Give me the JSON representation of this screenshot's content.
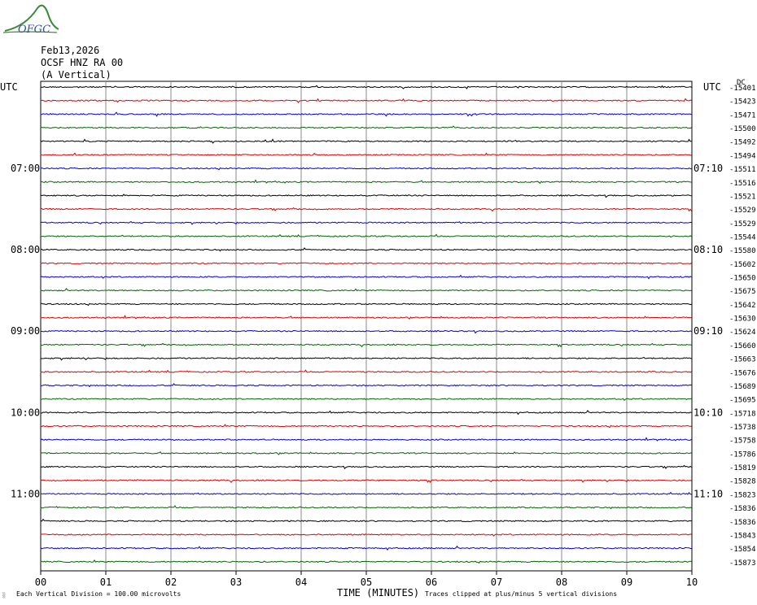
{
  "header": {
    "logo_text": "OFGC",
    "date": "Feb13,2026",
    "station": "OCSF HNZ RA 00",
    "component": "(A Vertical)"
  },
  "chart_data": {
    "type": "line",
    "title": "Feb13,2026",
    "left_axis_label": "UTC",
    "right_axis_label": "UTC",
    "right_axis_unit": "DC",
    "xlabel": "TIME (MINUTES)",
    "x_ticks": [
      "00",
      "01",
      "02",
      "03",
      "04",
      "05",
      "06",
      "07",
      "08",
      "09",
      "10"
    ],
    "xlim": [
      0,
      10
    ],
    "left_hour_labels": [
      "07:00",
      "08:00",
      "09:00",
      "10:00",
      "11:00"
    ],
    "right_hour_labels": [
      "07:10",
      "08:10",
      "09:10",
      "10:10",
      "11:10"
    ],
    "hour_label_trace_index": [
      6,
      12,
      18,
      24,
      30
    ],
    "trace_colors": [
      "#000000",
      "#dd0000",
      "#0000dd",
      "#006600"
    ],
    "dc_offsets": [
      -15401,
      -15423,
      -15471,
      -15500,
      -15492,
      -15494,
      -15511,
      -15516,
      -15521,
      -15529,
      -15529,
      -15544,
      -15580,
      -15602,
      -15650,
      -15675,
      -15642,
      -15630,
      -15624,
      -15660,
      -15663,
      -15676,
      -15689,
      -15695,
      -15718,
      -15738,
      -15758,
      -15786,
      -15819,
      -15828,
      -15823,
      -15836,
      -15836,
      -15843,
      -15854,
      -15873
    ],
    "grid": true,
    "footer_left": "Each Vertical Division =  100.00 microvolts",
    "footer_right": "Traces clipped at plus/minus 5 vertical divisions"
  }
}
